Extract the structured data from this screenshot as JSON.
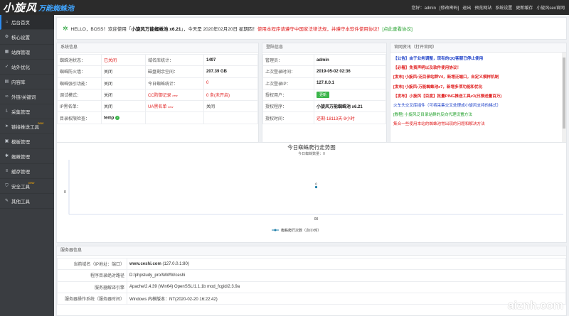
{
  "header": {
    "logo_text": "小旋风",
    "logo_slogan": "万能蜘蛛池",
    "greeting": "您好：",
    "user": "admin",
    "links": [
      "[修改密码]",
      "退出",
      "预览网站",
      "系统设置",
      "更新缓存",
      "小旋风seo官网"
    ]
  },
  "sidebar": {
    "items": [
      {
        "label": "后台首页",
        "icon": "home-icon",
        "active": true
      },
      {
        "label": "核心设置",
        "icon": "gear-icon"
      },
      {
        "label": "站群管理",
        "icon": "grid-icon"
      },
      {
        "label": "站外优化",
        "icon": "rocket-icon"
      },
      {
        "label": "内容库",
        "icon": "book-icon"
      },
      {
        "label": "外链/关键词",
        "icon": "link-icon"
      },
      {
        "label": "采集管理",
        "icon": "download-icon"
      },
      {
        "label": "链接推送工具",
        "icon": "send-icon",
        "badge": "new"
      },
      {
        "label": "模板管理",
        "icon": "template-icon"
      },
      {
        "label": "蜘蛛管理",
        "icon": "spider-icon"
      },
      {
        "label": "缓存管理",
        "icon": "database-icon"
      },
      {
        "label": "安全工具",
        "icon": "shield-icon",
        "badge": "new"
      },
      {
        "label": "其他工具",
        "icon": "tool-icon"
      }
    ]
  },
  "notice": {
    "p1": "HELLO，BOSS！欢迎使用「",
    "product": "小旋风万能蜘蛛池 x6.21",
    "p2": "」，今天是 2020年02月20日 星期四！",
    "warning": "使用本程序请遵守中国家法律法规，并遵守本软件使用协议！",
    "link": "[点此查看协议]"
  },
  "sysinfo": {
    "title": "系统信息",
    "rows": [
      [
        "蜘蛛池状态：",
        "已关闭",
        "域名库统计：",
        "1497"
      ],
      [
        "蜘蛛防火墙：",
        "关闭",
        "磁盘剩余空间：",
        "207.39 GB"
      ],
      [
        "蜘蛛强引功能：",
        "关闭",
        "今日蜘蛛统计：",
        "0"
      ],
      [
        "调试模式：",
        "关闭",
        "CC防御记录",
        "0 条(未开启)"
      ],
      [
        "IP黑名单：",
        "关闭",
        "UA黑名单",
        "关闭"
      ],
      [
        "目录权限检查：",
        "temp",
        "",
        ""
      ]
    ],
    "new_tag": "new"
  },
  "login": {
    "title": "登陆信息",
    "rows": [
      [
        "管理员：",
        "admin"
      ],
      [
        "上次登录时间：",
        "2019-05-02 02:36"
      ],
      [
        "上次登录IP：",
        "127.0.0.1"
      ],
      [
        "授权用户：",
        "更新"
      ],
      [
        "授权程序：",
        "小旋风万能蜘蛛池 x6.21"
      ],
      [
        "授权时间：",
        "还剩-18113天-9小时"
      ]
    ]
  },
  "news": {
    "title": "官网资讯（打开官网）",
    "items": [
      {
        "text": "【公告】由于业务调整，现有的QQ客服已停止使用",
        "color": "#1a3ec7",
        "bold": true
      },
      {
        "text": "【必看】免责声明以及软件使用协议！",
        "color": "#e02020",
        "bold": true
      },
      {
        "text": "[发布] 小旋风•泛目录站群V4，新增泛端口，自定义模样机制",
        "color": "#e02020",
        "bold": true
      },
      {
        "text": "[发布] 小旋风•万能蜘蛛池x7，新增多项功能和优化",
        "color": "#e02020",
        "bold": true
      },
      {
        "text": "【发布】小旋风【百度】批量PING推送工具v3(日推送量百万)",
        "color": "#e02020",
        "bold": true
      },
      {
        "text": "火车头交叉库插件（可将采集交叉处理成小旋风支持的格式）",
        "color": "#1a3ec7",
        "bold": false
      },
      {
        "text": "[教程] 小旋风泛目录站群的反向代理设置方法",
        "color": "#23a12c",
        "bold": false
      },
      {
        "text": "集合一些使用本站的蜘蛛池常出现的问题和解决方法",
        "color": "#e02020",
        "bold": false
      }
    ]
  },
  "chart_data": {
    "type": "line",
    "title": "今日蜘蛛爬行走势图",
    "subtitle": "今日蜘蛛数量：0",
    "categories": [
      "00"
    ],
    "series": [
      {
        "name": "蜘蛛爬行次数（次/小时）",
        "values": [
          0
        ]
      }
    ],
    "y_tick": "0",
    "color": "#1c7ea8"
  },
  "server": {
    "title": "服务器信息",
    "rows": [
      [
        "当前域名（IP地址：端口）",
        "www.ceshi.com",
        "(127.0.0.1:80)"
      ],
      [
        "程序目录绝对路径",
        "D:/phpstudy_pro/WWW/ceshi",
        ""
      ],
      [
        "服务器解译引擎",
        "Apache/2.4.39 (Win64) OpenSSL/1.1.1b mod_fcgid/2.3.9a",
        ""
      ],
      [
        "服务器操作系统（服务器时间）",
        "Windows 内核版本：NT(2020-02-20 16:22:42)",
        ""
      ]
    ]
  },
  "watermark": "aiznh.com"
}
